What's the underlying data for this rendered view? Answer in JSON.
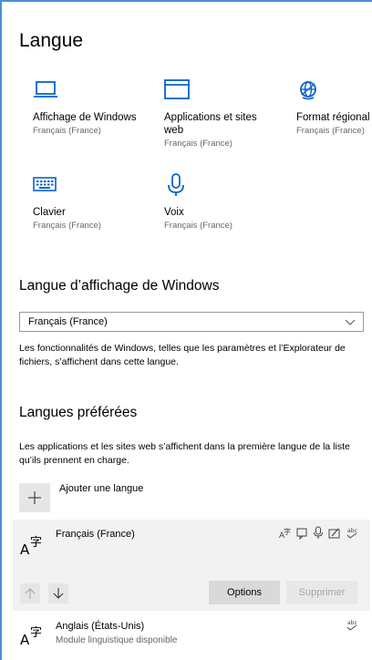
{
  "page": {
    "title": "Langue"
  },
  "tiles": [
    {
      "label": "Affichage de Windows",
      "sub": "Français (France)",
      "icon": "laptop-icon"
    },
    {
      "label": "Applications et sites web",
      "sub": "Français (France)",
      "icon": "window-icon"
    },
    {
      "label": "Format régional",
      "sub": "Français (France)",
      "icon": "globe-icon"
    },
    {
      "label": "Clavier",
      "sub": "Français (France)",
      "icon": "keyboard-icon"
    },
    {
      "label": "Voix",
      "sub": "Français (France)",
      "icon": "microphone-icon"
    }
  ],
  "display_language": {
    "heading": "Langue d’affichage de Windows",
    "selected": "Français (France)",
    "description": "Les fonctionnalités de Windows, telles que les paramètres et l’Explorateur de fichiers, s’affichent dans cette langue."
  },
  "preferred": {
    "heading": "Langues préférées",
    "description": "Les applications et les sites web s’affichent dans la première langue de la liste qu’ils prennent en charge.",
    "add_label": "Ajouter une langue",
    "languages": [
      {
        "name": "Français (France)",
        "sub": ""
      },
      {
        "name": "Anglais (États-Unis)",
        "sub": "Module linguistique disponible"
      }
    ],
    "options_label": "Options",
    "remove_label": "Supprimer"
  },
  "colors": {
    "accent": "#0a62c9",
    "frame": "#4a8fd6"
  }
}
